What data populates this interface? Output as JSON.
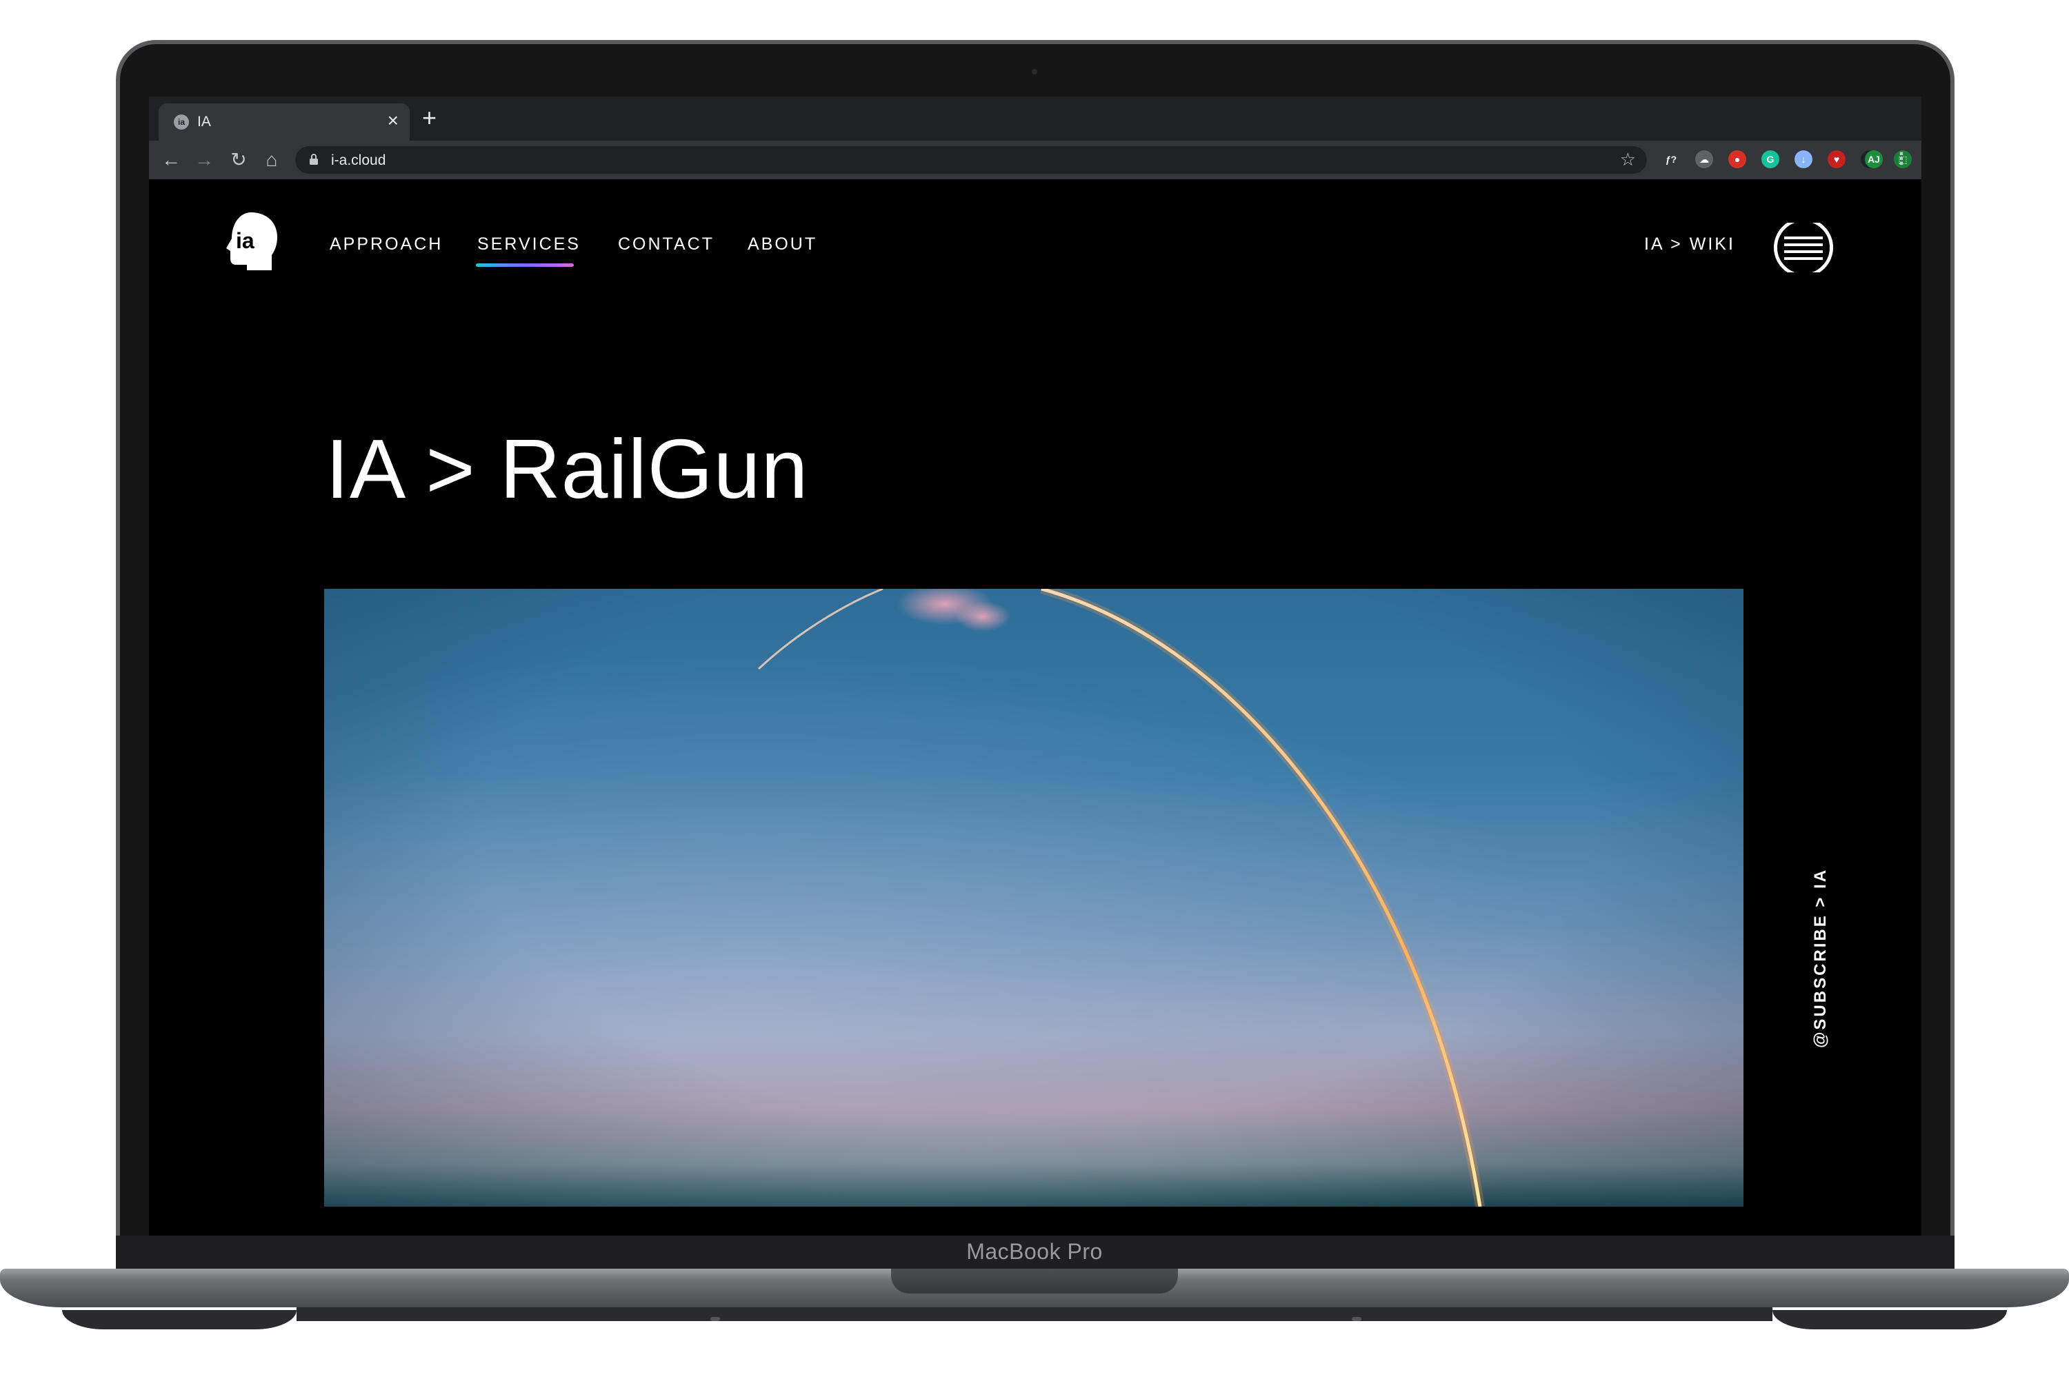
{
  "device": {
    "label": "MacBook Pro"
  },
  "browser": {
    "tab": {
      "title": "IA",
      "favicon": "ia-head-icon"
    },
    "new_tab_icon": "+",
    "address": {
      "url": "i-a.cloud"
    },
    "nav": {
      "back": "←",
      "forward": "→",
      "reload": "↻",
      "home": "⌂"
    },
    "profile_initials": "AJ",
    "extensions": [
      {
        "name": "function-icon",
        "color": "#35363a",
        "glyph": "ƒ?"
      },
      {
        "name": "cloud-icon",
        "color": "#5f6368",
        "glyph": "☁"
      },
      {
        "name": "red-drop-icon",
        "color": "#d93025",
        "glyph": "●"
      },
      {
        "name": "grammarly-icon",
        "color": "#15c39a",
        "glyph": "G"
      },
      {
        "name": "download-icon",
        "color": "#8ab4f8",
        "glyph": "↓"
      },
      {
        "name": "heart-shield-icon",
        "color": "#c5221f",
        "glyph": "♥"
      },
      {
        "name": "clipper-icon",
        "color": "#202124",
        "glyph": "▣"
      },
      {
        "name": "screenshot-icon",
        "color": "#188038",
        "glyph": "⬚"
      },
      {
        "name": "eyedropper-icon",
        "color": "#35363a",
        "glyph": "✎"
      },
      {
        "name": "puzzle-icon",
        "color": "#35363a",
        "glyph": "✚"
      }
    ]
  },
  "site": {
    "logo_text": "ia",
    "nav": [
      {
        "label": "APPROACH",
        "active": false
      },
      {
        "label": "SERVICES",
        "active": true
      },
      {
        "label": "CONTACT",
        "active": false
      },
      {
        "label": "ABOUT",
        "active": false
      }
    ],
    "wiki_link": "IA > WIKI",
    "title": "IA > RailGun",
    "hero_alt": "rocket launch trail arcing across dusk sky",
    "subscribe": "@SUBSCRIBE > IA",
    "accent_gradient": [
      "#23c4d8",
      "#7b6cf0",
      "#e066e0"
    ]
  }
}
